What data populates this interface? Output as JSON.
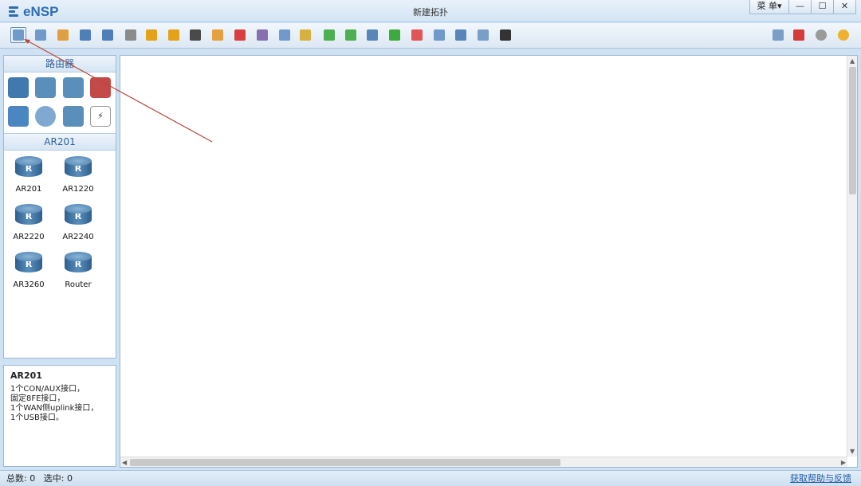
{
  "app": {
    "logo_text": "eNSP",
    "window_title": "新建拓扑",
    "menu_label": "菜 单▾",
    "window_buttons": [
      "—",
      "☐",
      "✕"
    ]
  },
  "toolbar": {
    "left_icons": [
      "new-topology-icon",
      "new-example-icon",
      "open-icon",
      "save-icon",
      "save-as-icon",
      "print-icon",
      "undo-icon",
      "redo-icon",
      "select-icon",
      "pan-hand-icon",
      "delete-icon",
      "delete-link-icon",
      "text-icon",
      "label-icon",
      "zoom-in-icon",
      "zoom-out-icon",
      "fit-window-icon",
      "start-device-icon",
      "stop-device-icon",
      "capture-icon",
      "topology-icon",
      "area-icon",
      "screenshot-icon"
    ],
    "left_colors": [
      "#6f9acb",
      "#6f9acb",
      "#e0a040",
      "#4f7fb8",
      "#4f7fb8",
      "#8a8a8a",
      "#e3a21a",
      "#e3a21a",
      "#4a4a4a",
      "#e5a040",
      "#d64040",
      "#8a6fb0",
      "#6f9acb",
      "#d8b040",
      "#4caf50",
      "#4caf50",
      "#5a85b8",
      "#3daa3d",
      "#e05555",
      "#6f9acb",
      "#5a85b8",
      "#7a9ec6",
      "#333333"
    ],
    "right_icons": [
      "chat-icon",
      "huawei-icon",
      "settings-icon",
      "help-icon"
    ],
    "right_colors": [
      "#7a9ec6",
      "#d53b3b",
      "#9a9a9a",
      "#f0b030"
    ]
  },
  "left_panel": {
    "category_header": "路由器",
    "categories": [
      {
        "icon": "router-category-icon",
        "color": "#3f79ad"
      },
      {
        "icon": "switch-category-icon",
        "color": "#5b8fbb"
      },
      {
        "icon": "wireless-category-icon",
        "color": "#5b8fbb"
      },
      {
        "icon": "firewall-category-icon",
        "color": "#c44a4a"
      },
      {
        "icon": "pc-category-icon",
        "color": "#4a86c0"
      },
      {
        "icon": "cloud-category-icon",
        "color": "#7fa9d0"
      },
      {
        "icon": "other-device-category-icon",
        "color": "#5b8fbb"
      },
      {
        "icon": "link-category-icon",
        "color": "#333333"
      }
    ],
    "device_header": "AR201",
    "devices": [
      {
        "label": "AR201",
        "glyph": "R"
      },
      {
        "label": "AR1220",
        "glyph": "R"
      },
      {
        "label": "AR2220",
        "glyph": "R"
      },
      {
        "label": "AR2240",
        "glyph": "R"
      },
      {
        "label": "AR3260",
        "glyph": "R"
      },
      {
        "label": "Router",
        "glyph": "R"
      }
    ]
  },
  "info_panel": {
    "title": "AR201",
    "lines": [
      "1个CON/AUX接口，",
      "固定8FE接口，",
      "1个WAN侧uplink接口，",
      "1个USB接口。"
    ]
  },
  "status_bar": {
    "total_label": "总数:",
    "total_value": "0",
    "selected_label": "选中:",
    "selected_value": "0",
    "help_link": "获取帮助与反馈"
  }
}
